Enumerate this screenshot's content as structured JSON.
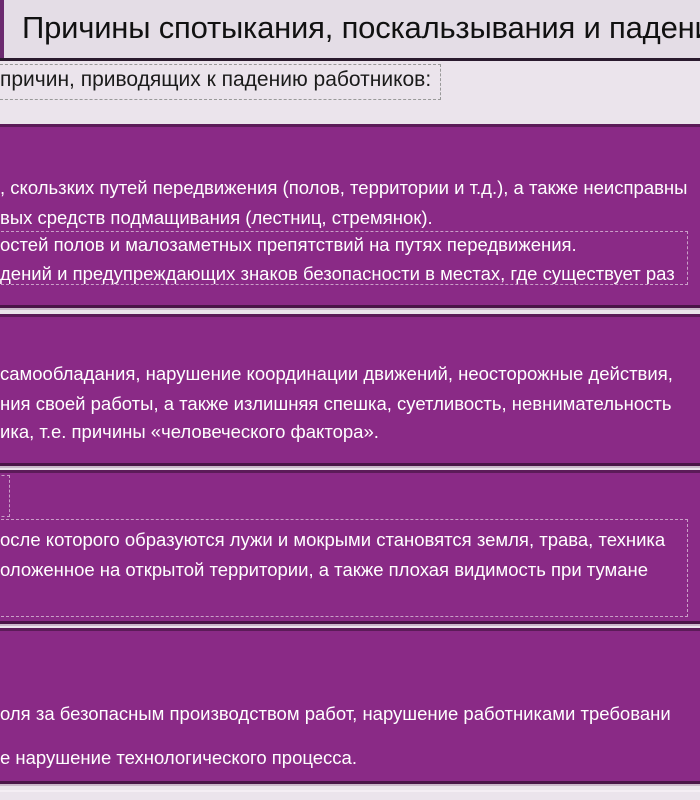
{
  "title": "Причины спотыкания, поскальзывания и падения",
  "subtitle": "причин, приводящих к падению работников:",
  "sections": [
    {
      "lines": [
        ", скользких путей передвижения (полов, территории и т.д.), а также неисправны",
        "вых средств подмащивания (лестниц, стремянок).",
        "остей полов и малозаметных препятствий на путях передвижения.",
        "дений и предупреждающих знаков безопасности в местах, где существует раз"
      ]
    },
    {
      "lines": [
        " самообладания, нарушение координации движений, неосторожные действия,",
        "ния своей работы, а также излишняя спешка, суетливость, невнимательность",
        "ика, т.е. причины «человеческого фактора»."
      ]
    },
    {
      "lines": [
        "осле которого образуются лужи и мокрыми становятся земля, трава, техника",
        "оложенное на открытой территории, а также плохая видимость при тумане"
      ]
    },
    {
      "lines": [
        "оля за безопасным производством работ, нарушение работниками требовани",
        "е нарушение технологического процесса."
      ]
    }
  ]
}
